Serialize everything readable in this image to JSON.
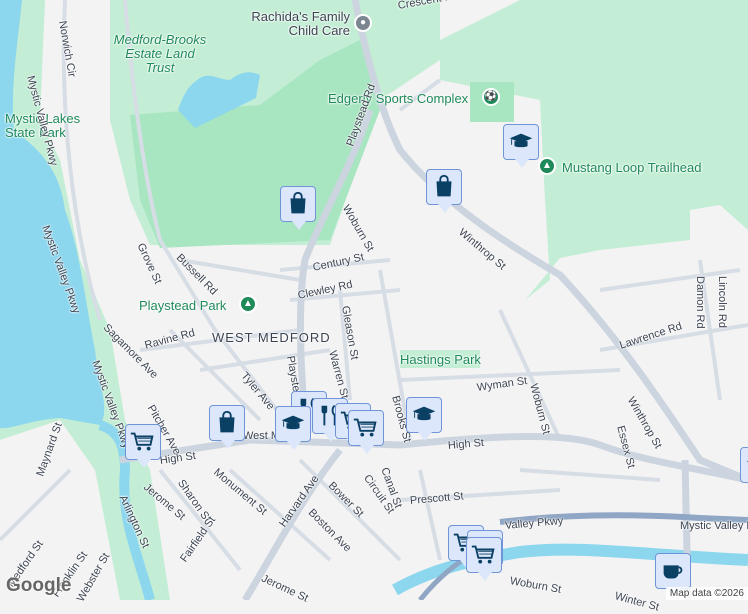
{
  "map": {
    "colors": {
      "water": "#8dd7ee",
      "park": "#c3eed5",
      "park_dark": "#a8e5c1",
      "road": "#d7dde5",
      "highway": "#8fa6c4",
      "pin_fill": "#dde7fb",
      "pin_border": "#6f95d8",
      "icon": "#0b4065",
      "park_text": "#1e8a5a"
    },
    "places": {
      "rachidas": "Rachida's Family Child Care",
      "medford_brooks": "Medford-Brooks Estate Land Trust",
      "mystic_lakes": "Mystic Lakes State Park",
      "edgerly": "Edgerly Sports Complex",
      "mustang": "Mustang Loop Trailhead",
      "playstead_park": "Playstead Park",
      "hastings_park": "Hastings Park",
      "west_medford": "WEST MEDFORD"
    },
    "streets": [
      "Norwich Cir",
      "Mystic Valley Pkwy",
      "Mystic Valley Pkwy",
      "Playstead Rd",
      "Woburn St",
      "Winthrop St",
      "Bussell Rd",
      "Grove St",
      "Century St",
      "Clewley Rd",
      "Gleason St",
      "Ravine Rd",
      "Warren St",
      "Playstead Rd",
      "Sagamore Ave",
      "Tyler Ave",
      "Pitcher Ave",
      "Mystic Valley Pkwy",
      "West Medford",
      "High St",
      "Maynard St",
      "Sharon St",
      "Monument St",
      "Jerome St",
      "Harvard Ave",
      "Bower St",
      "Circuit St",
      "Boston Ave",
      "Arlington St",
      "Fairfield St",
      "Medford St",
      "Franklin St",
      "Webster St",
      "Jerome St",
      "Lawrence Rd",
      "Wyman St",
      "Woburn St",
      "Brooks St",
      "High St",
      "Winthrop St",
      "Essex St",
      "Canal St",
      "Prescott St",
      "Valley Pkwy",
      "Woburn St",
      "Damon Rd",
      "Lincoln Rd",
      "Winter St",
      "Crescent Rd",
      "Mystic Valley Pkwy"
    ],
    "markers": [
      {
        "type": "shopping"
      },
      {
        "type": "shopping"
      },
      {
        "type": "school"
      },
      {
        "type": "grocery"
      },
      {
        "type": "shopping"
      },
      {
        "type": "restaurant"
      },
      {
        "type": "restaurant"
      },
      {
        "type": "school"
      },
      {
        "type": "grocery"
      },
      {
        "type": "grocery"
      },
      {
        "type": "school"
      },
      {
        "type": "grocery"
      },
      {
        "type": "grocery"
      },
      {
        "type": "grocery"
      },
      {
        "type": "cafe"
      },
      {
        "type": "school"
      }
    ],
    "logo": "Google",
    "attribution": "Map data ©2026"
  }
}
